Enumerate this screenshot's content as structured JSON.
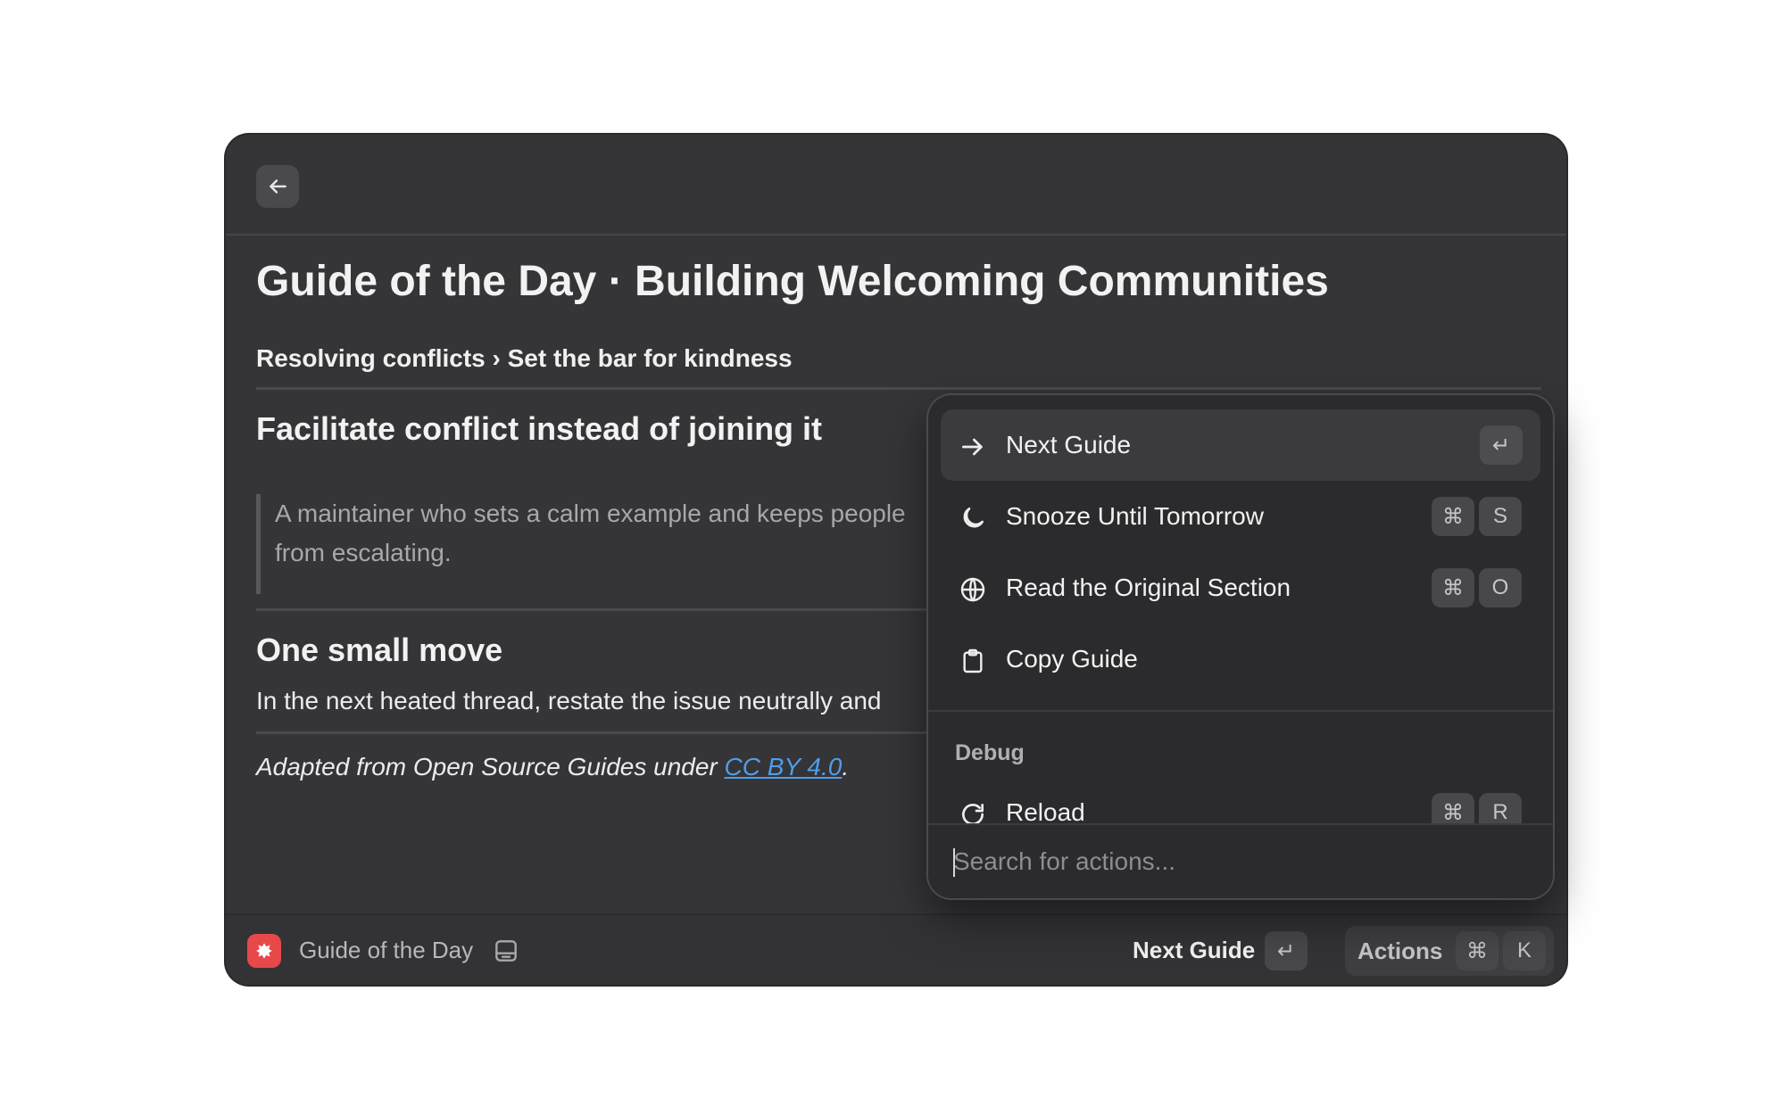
{
  "header": {
    "back_icon": "arrow-left-icon"
  },
  "page": {
    "title": "Guide of the Day · Building Welcoming Communities",
    "breadcrumb": "Resolving conflicts › Set the bar for kindness",
    "section1_heading": "Facilitate conflict instead of joining it",
    "quote": "A maintainer who sets a calm example and keeps people from escalating.",
    "section2_heading": "One small move",
    "body": "In the next heated thread, restate the issue neutrally and",
    "footnote_prefix": "Adapted from Open Source Guides under ",
    "footnote_link": "CC BY 4.0",
    "footnote_suffix": "."
  },
  "bottombar": {
    "app_name": "Guide of the Day",
    "primary_action": "Next Guide",
    "primary_key": "↵",
    "actions_label": "Actions",
    "actions_key_mod": "⌘",
    "actions_key": "K"
  },
  "actions_panel": {
    "items": [
      {
        "label": "Next Guide",
        "icon": "arrow-right-icon",
        "keys": [
          "↵"
        ],
        "selected": true
      },
      {
        "label": "Snooze Until Tomorrow",
        "icon": "moon-icon",
        "keys": [
          "⌘",
          "S"
        ]
      },
      {
        "label": "Read the Original Section",
        "icon": "globe-icon",
        "keys": [
          "⌘",
          "O"
        ]
      },
      {
        "label": "Copy Guide",
        "icon": "clipboard-icon",
        "keys": []
      }
    ],
    "debug_section": "Debug",
    "debug_items": [
      {
        "label": "Reload",
        "icon": "reload-icon",
        "keys": [
          "⌘",
          "R"
        ]
      }
    ],
    "search_placeholder": "Search for actions..."
  },
  "colors": {
    "window_bg": "#353437",
    "panel_bg": "#2b2a2c",
    "accent_link": "#4f9ee8",
    "app_icon_red": "#e8484a"
  }
}
